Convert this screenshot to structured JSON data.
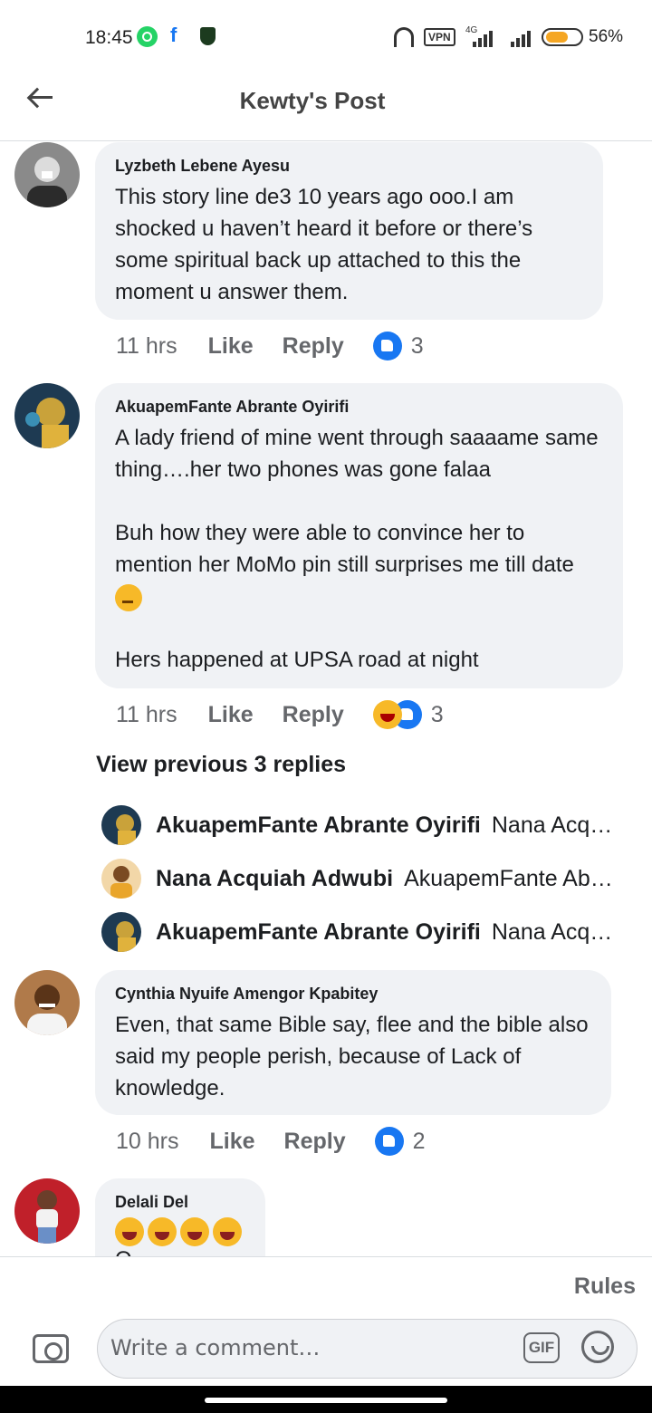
{
  "status_bar": {
    "time": "18:45",
    "vpn_label": "VPN",
    "network_label": "4G",
    "battery_percent": "56%",
    "icons": [
      "whatsapp-icon",
      "facebook-icon",
      "shield-icon",
      "headphones-icon",
      "signal-icon",
      "battery-icon"
    ]
  },
  "header": {
    "title": "Kewty's Post",
    "back_icon": "back-arrow-icon"
  },
  "comments": [
    {
      "author": "Lyzbeth Lebene Ayesu",
      "text": "This story line de3 10 years ago ooo.I am shocked u haven’t heard it before or there’s some spiritual back up attached to this the moment u answer them.",
      "time": "11 hrs",
      "like_label": "Like",
      "reply_label": "Reply",
      "reaction_count": "3",
      "reactions": [
        "like-icon"
      ]
    },
    {
      "author": "AkuapemFante Abrante Oyirifi",
      "text_p1": "A lady friend of mine went through saaaame same thing….her two phones was gone falaa",
      "text_p2": "Buh how they were able to convince her to mention her MoMo pin still surprises me till date",
      "text_p3": "Hers happened at UPSA road at night",
      "time": "11 hrs",
      "like_label": "Like",
      "reply_label": "Reply",
      "reaction_count": "3",
      "reactions": [
        "haha-icon",
        "like-icon"
      ]
    },
    {
      "author": "Cynthia Nyuife Amengor Kpabitey",
      "text": "Even, that same Bible say, flee and the bible also said my people perish, because of Lack of knowledge.",
      "time": "10 hrs",
      "like_label": "Like",
      "reply_label": "Reply",
      "reaction_count": "2",
      "reactions": [
        "like-icon"
      ]
    },
    {
      "author": "Delali Del",
      "text": "😂😂😂😂",
      "text_partial": "O"
    }
  ],
  "replies": {
    "view_previous_label": "View previous 3 replies",
    "items": [
      {
        "name": "AkuapemFante Abrante Oyirifi",
        "snippet": "Nana Acquiah Adwubi"
      },
      {
        "name": "Nana Acquiah Adwubi",
        "snippet": "AkuapemFante Abrante Oyirifi"
      },
      {
        "name": "AkuapemFante Abrante Oyirifi",
        "snippet": "Nana Acquiah Adwubi"
      }
    ]
  },
  "composer": {
    "rules_label": "Rules",
    "placeholder": "Write a comment…",
    "gif_label": "GIF",
    "icons": [
      "camera-icon",
      "gif-icon",
      "emoji-icon"
    ]
  }
}
